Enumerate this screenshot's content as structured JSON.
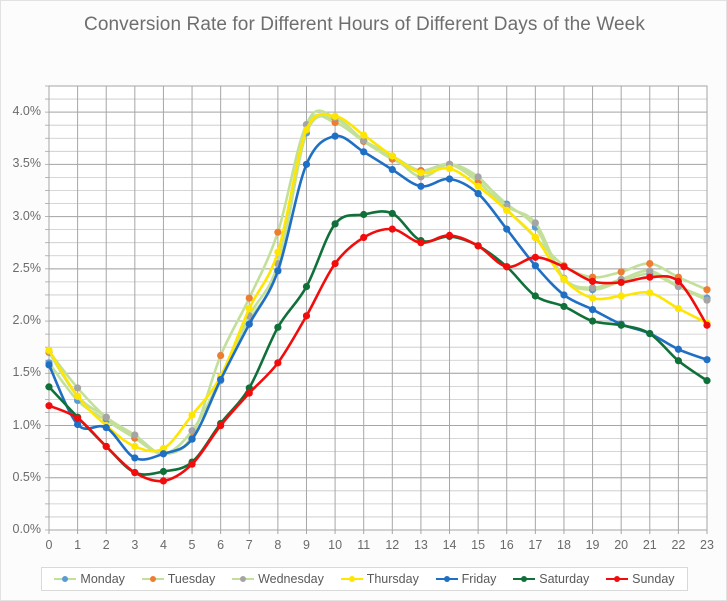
{
  "chart": {
    "title": "Conversion Rate for Different Hours of Different Days of the Week"
  },
  "legend": {
    "position": "bottom",
    "items": [
      {
        "label": "Monday",
        "line_color": "#c3e09a",
        "marker_color": "#5b9bd5"
      },
      {
        "label": "Tuesday",
        "line_color": "#c3e09a",
        "marker_color": "#ed7d31"
      },
      {
        "label": "Wednesday",
        "line_color": "#c3e09a",
        "marker_color": "#a5a5a5"
      },
      {
        "label": "Thursday",
        "line_color": "#ffe600",
        "marker_color": "#ffe600"
      },
      {
        "label": "Friday",
        "line_color": "#1f6fc4",
        "marker_color": "#1f6fc4"
      },
      {
        "label": "Saturday",
        "line_color": "#10703a",
        "marker_color": "#10703a"
      },
      {
        "label": "Sunday",
        "line_color": "#f20d0d",
        "marker_color": "#f20d0d"
      }
    ]
  },
  "chart_data": {
    "type": "line",
    "title": "Conversion Rate for Different Hours of Different Days of the Week",
    "xlabel": "",
    "ylabel": "",
    "grid": true,
    "minor_grid": true,
    "xlim": [
      0,
      23
    ],
    "ylim": [
      0.0,
      4.25
    ],
    "ytick_values": [
      0.0,
      0.5,
      1.0,
      1.5,
      2.0,
      2.5,
      3.0,
      3.5,
      4.0
    ],
    "ytick_labels": [
      "0.0%",
      "0.5%",
      "1.0%",
      "1.5%",
      "2.0%",
      "2.5%",
      "3.0%",
      "3.5%",
      "4.0%"
    ],
    "x": [
      0,
      1,
      2,
      3,
      4,
      5,
      6,
      7,
      8,
      9,
      10,
      11,
      12,
      13,
      14,
      15,
      16,
      17,
      18,
      19,
      20,
      21,
      22,
      23
    ],
    "xtick_labels": [
      "0",
      "1",
      "2",
      "3",
      "4",
      "5",
      "6",
      "7",
      "8",
      "9",
      "10",
      "11",
      "12",
      "13",
      "14",
      "15",
      "16",
      "17",
      "18",
      "19",
      "20",
      "21",
      "22",
      "23"
    ],
    "series": [
      {
        "name": "Monday",
        "color": "#5b9bd5",
        "line_color": "#c3e09a",
        "values": [
          1.6,
          1.24,
          1.05,
          0.88,
          0.73,
          0.87,
          1.43,
          2.0,
          2.49,
          3.8,
          3.93,
          3.72,
          3.58,
          3.44,
          3.5,
          3.36,
          3.12,
          2.9,
          2.4,
          2.3,
          2.38,
          2.45,
          2.33,
          2.22
        ]
      },
      {
        "name": "Tuesday",
        "color": "#ed7d31",
        "line_color": "#c3e09a",
        "values": [
          1.7,
          1.28,
          1.08,
          0.88,
          0.73,
          0.9,
          1.67,
          2.22,
          2.85,
          3.88,
          3.9,
          3.72,
          3.55,
          3.44,
          3.5,
          3.33,
          3.07,
          2.8,
          2.53,
          2.42,
          2.47,
          2.55,
          2.42,
          2.3
        ]
      },
      {
        "name": "Wednesday",
        "color": "#a5a5a5",
        "line_color": "#c3e09a",
        "values": [
          1.71,
          1.36,
          1.08,
          0.91,
          0.73,
          0.95,
          1.45,
          2.05,
          2.55,
          3.88,
          3.95,
          3.73,
          3.58,
          3.38,
          3.5,
          3.38,
          3.1,
          2.94,
          2.41,
          2.32,
          2.4,
          2.48,
          2.33,
          2.2
        ]
      },
      {
        "name": "Thursday",
        "color": "#ffe600",
        "line_color": "#ffe600",
        "values": [
          1.72,
          1.28,
          1.0,
          0.8,
          0.78,
          1.1,
          1.47,
          2.12,
          2.66,
          3.83,
          3.96,
          3.78,
          3.58,
          3.42,
          3.46,
          3.29,
          3.06,
          2.8,
          2.4,
          2.22,
          2.24,
          2.27,
          2.12,
          1.98
        ]
      },
      {
        "name": "Friday",
        "color": "#1f6fc4",
        "line_color": "#1f6fc4",
        "values": [
          1.58,
          1.01,
          0.98,
          0.69,
          0.73,
          0.87,
          1.44,
          1.97,
          2.48,
          3.5,
          3.77,
          3.62,
          3.45,
          3.29,
          3.36,
          3.22,
          2.88,
          2.53,
          2.25,
          2.11,
          1.97,
          1.88,
          1.73,
          1.63
        ]
      },
      {
        "name": "Saturday",
        "color": "#10703a",
        "line_color": "#10703a",
        "values": [
          1.37,
          1.08,
          0.8,
          0.55,
          0.56,
          0.65,
          1.02,
          1.36,
          1.94,
          2.33,
          2.93,
          3.02,
          3.03,
          2.77,
          2.81,
          2.72,
          2.52,
          2.24,
          2.14,
          2.0,
          1.96,
          1.88,
          1.62,
          1.43
        ]
      },
      {
        "name": "Sunday",
        "color": "#f20d0d",
        "line_color": "#f20d0d",
        "values": [
          1.19,
          1.07,
          0.8,
          0.55,
          0.47,
          0.63,
          1.0,
          1.31,
          1.6,
          2.05,
          2.55,
          2.8,
          2.88,
          2.75,
          2.82,
          2.72,
          2.52,
          2.61,
          2.52,
          2.38,
          2.37,
          2.42,
          2.38,
          1.96
        ]
      }
    ]
  }
}
